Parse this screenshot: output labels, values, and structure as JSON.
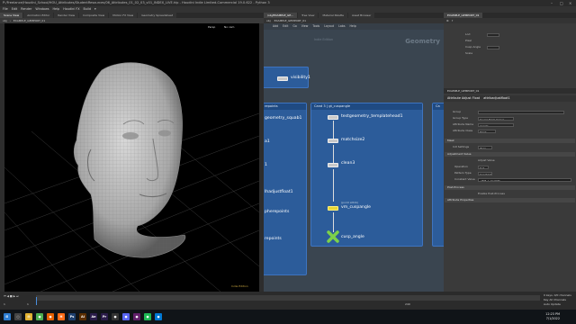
{
  "window": {
    "title": "P:/Freelance/Houdini_School/HOU_Attributes/StudentResources/06_Attributes_01_02_03_v01_INDEX_LIVE.hip - Houdini Indie Limited-Commercial 19.0.622 - Python 3",
    "controls": [
      "–",
      "□",
      "×"
    ]
  },
  "menu": [
    "File",
    "Edit",
    "Render",
    "Windows",
    "Help",
    "Houdini FX",
    "Build",
    "▾"
  ],
  "viewport": {
    "tabs": [
      "Scene View",
      "Animation Editor",
      "Render View",
      "Composite View",
      "Motion FX View",
      "Geometry Spreadsheet"
    ],
    "path": "obj",
    "node_path": "EXAMPLE_GEMPORT_01",
    "persp_label": "Persp",
    "cam_label": "No cam",
    "engine_label": "Indie Edition"
  },
  "network": {
    "tabs": [
      "/obj/EXAMPLE_GE...",
      "Tree View",
      "Material Palette",
      "Asset Browser"
    ],
    "path_obj": "obj",
    "path_node": "EXAMPLE_GEMPORT_01",
    "menu": [
      "Add",
      "Edit",
      "Go",
      "View",
      "Tools",
      "Layout",
      "Labs",
      "Help"
    ],
    "context_label": "Geometry",
    "edition_label": "Indie Edition",
    "boxes": [
      {
        "title": ""
      },
      {
        "title": "repoints"
      },
      {
        "title": "Cand 3 | gt_cuspangle"
      },
      {
        "title": "Ca"
      }
    ],
    "nodes": {
      "visibility": "visibility1",
      "geo_squab": "geometry_squab1",
      "left_a": "a1",
      "left_b": "1",
      "left_c": "lhadjustfloat1",
      "left_d": "pherepoints",
      "left_e": "repoints",
      "template": "testgeometry_templatehead1",
      "matchsize": "matchsize2",
      "clean": "clean3",
      "cuspangle": "vm_cuspangle",
      "cuspangle_sub": "(point attrib)",
      "cusp": "cusp_angle"
    }
  },
  "params": {
    "tabs": [
      "EXAMPLE_GEMPORT_01"
    ],
    "node_type": "Attribute Adjust Float",
    "node_name": "attribadjustfloat1",
    "top_fields": [
      {
        "label": "Lod",
        "value": ""
      },
      {
        "label": "Pixel",
        "value": ""
      },
      {
        "label": "Cusp Angle",
        "value": ""
      },
      {
        "label": "Scale",
        "value": ""
      }
    ],
    "fields": [
      {
        "label": "Group",
        "value": ""
      },
      {
        "label": "Group Type",
        "value": "Guess from Group"
      },
      {
        "label": "Attribute Name",
        "value": "pscale"
      },
      {
        "label": "Attribute Class",
        "value": "Point"
      }
    ],
    "sections": [
      "Mask",
      "Adjustment Value",
      "Post-Process",
      "Attribute Properties"
    ],
    "init_label": "Init Settings",
    "init_value": "Zero",
    "adjust_label": "Adjust Value",
    "operation_label": "Operation",
    "operation_value": "Set",
    "pattern_label": "Pattern Type",
    "pattern_value": "Constant",
    "constant_label": "Constant Value",
    "constant_value": "-ch(\"../../cusp\")",
    "enable_post": "Enable Post-Process"
  },
  "timeline": {
    "frame": "1",
    "start": "1",
    "end": "240",
    "keys_label": "0 keys, 0/0 channels",
    "key_all_label": "Key All Channels",
    "auto_update": "Auto Update"
  },
  "taskbar": {
    "icons": [
      {
        "name": "windows",
        "label": "⊞",
        "color": "#2d7dd2"
      },
      {
        "name": "search",
        "label": "○",
        "color": "#444"
      },
      {
        "name": "explorer",
        "label": "▤",
        "color": "#e0b130"
      },
      {
        "name": "chrome",
        "label": "●",
        "color": "#4caf50"
      },
      {
        "name": "firefox",
        "label": "●",
        "color": "#e66000"
      },
      {
        "name": "houdini",
        "label": "H",
        "color": "#ff6c17"
      },
      {
        "name": "photoshop",
        "label": "Ps",
        "color": "#1d3f6e"
      },
      {
        "name": "illustrator",
        "label": "Ai",
        "color": "#5a2d00"
      },
      {
        "name": "aftereffects",
        "label": "Ae",
        "color": "#2a1c4a"
      },
      {
        "name": "premiere",
        "label": "Pr",
        "color": "#2a1c4a"
      },
      {
        "name": "obs",
        "label": "●",
        "color": "#333"
      },
      {
        "name": "discord",
        "label": "●",
        "color": "#5865f2"
      },
      {
        "name": "slack",
        "label": "●",
        "color": "#611f69"
      },
      {
        "name": "spotify",
        "label": "●",
        "color": "#1db954"
      },
      {
        "name": "vscode",
        "label": "●",
        "color": "#0078d4"
      }
    ],
    "time": "12:23 PM",
    "date": "7/1/2022"
  }
}
